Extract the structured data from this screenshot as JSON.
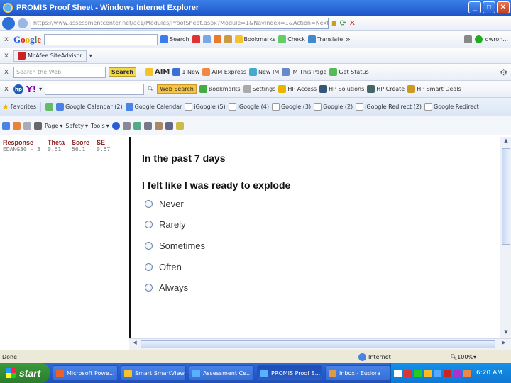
{
  "window": {
    "title": "PROMIS Proof Sheet - Windows Internet Explorer"
  },
  "address": {
    "url": "https://www.assessmentcenter.net/ac1/Modules/ProofSheet.aspx?Module=1&NavIndex=1&Action=Next"
  },
  "google_bar": {
    "search_label": "Search",
    "bookmarks_label": "Bookmarks",
    "check_label": "Check",
    "translate_label": "Translate",
    "more": "»",
    "user": "dwron..."
  },
  "mcafee_bar": {
    "label": "McAfee SiteAdvisor"
  },
  "aim_bar": {
    "search_placeholder": "Search the Web",
    "search_button": "Search",
    "aim_label": "AIM",
    "new_label": "1 New",
    "aim_express": "AIM Express",
    "new_im": "New IM",
    "im_page": "IM This Page",
    "get_status": "Get Status"
  },
  "yahoo_bar": {
    "web_search": "Web Search",
    "bookmarks": "Bookmarks",
    "settings": "Settings",
    "hp_access": "HP Access",
    "hp_solutions": "HP Solutions",
    "hp_create": "HP Create",
    "hp_deals": "HP Smart Deals"
  },
  "favorites_bar": {
    "favorites_label": "Favorites",
    "links": [
      "Google Calendar (2)",
      "Google Calendar",
      "iGoogle (5)",
      "iGoogle (4)",
      "Google (3)",
      "Google (2)",
      "iGoogle Redirect (2)",
      "Google Redirect"
    ]
  },
  "command_bar": {
    "page": "Page",
    "safety": "Safety",
    "tools": "Tools"
  },
  "score_table": {
    "headers": [
      "Response",
      "Theta",
      "Score",
      "SE"
    ],
    "row": [
      "EDANG30 - 3",
      "0.61",
      "56.1",
      "0.57"
    ]
  },
  "survey": {
    "context": "In the past 7 days",
    "question": "I felt like I was ready to explode",
    "options": [
      "Never",
      "Rarely",
      "Sometimes",
      "Often",
      "Always"
    ]
  },
  "status": {
    "left": "Done",
    "zone": "Internet",
    "zoom": "100%"
  },
  "taskbar": {
    "start": "start",
    "tasks": [
      "Microsoft Powe...",
      "Smart SmartView",
      "Assessment Ce...",
      "PROMIS Proof S...",
      "Inbox - Eudora"
    ],
    "clock": "6:20 AM"
  }
}
